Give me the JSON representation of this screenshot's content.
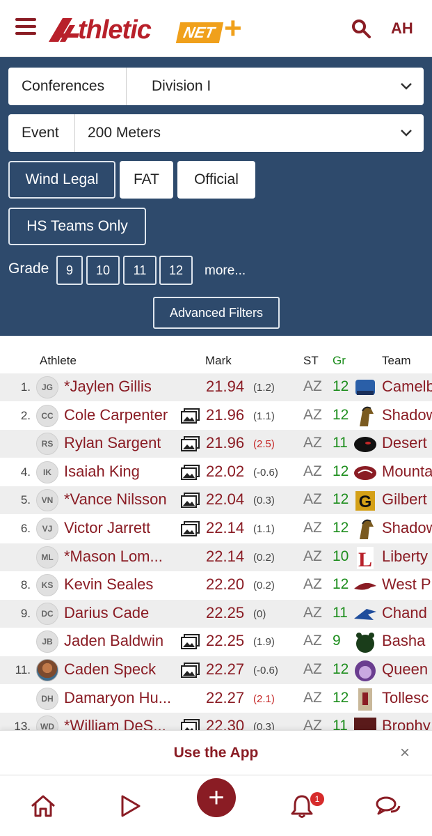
{
  "header": {
    "logo_word": "thletic",
    "logo_net": "NET",
    "logo_plus": "+",
    "user_initials": "AH"
  },
  "filters": {
    "conferences": {
      "label": "Conferences",
      "value": "Division I"
    },
    "event": {
      "label": "Event",
      "value": "200 Meters"
    },
    "toggles": [
      "Wind Legal",
      "FAT",
      "Official"
    ],
    "hs_teams_only": "HS Teams Only",
    "grade_label": "Grade",
    "grades": [
      "9",
      "10",
      "11",
      "12"
    ],
    "more": "more...",
    "advanced": "Advanced Filters"
  },
  "table": {
    "columns": {
      "athlete": "Athlete",
      "mark": "Mark",
      "st": "ST",
      "gr": "Gr",
      "team": "Team"
    },
    "rows": [
      {
        "rank": "1.",
        "initials": "JG",
        "name": "*Jaylen Gillis",
        "photo": false,
        "mark": "21.94",
        "wind": "(1.2)",
        "illegal": false,
        "st": "AZ",
        "gr": "12",
        "team": "Camelb",
        "logo": "trojan-logo"
      },
      {
        "rank": "2.",
        "initials": "CC",
        "name": "Cole Carpenter",
        "photo": true,
        "mark": "21.96",
        "wind": "(1.1)",
        "illegal": false,
        "st": "AZ",
        "gr": "12",
        "team": "Shadow",
        "logo": "stallion-logo"
      },
      {
        "rank": "",
        "initials": "RS",
        "name": "Rylan Sargent",
        "photo": true,
        "mark": "21.96",
        "wind": "(2.5)",
        "illegal": true,
        "st": "AZ",
        "gr": "11",
        "team": "Desert",
        "logo": "panther-logo"
      },
      {
        "rank": "4.",
        "initials": "IK",
        "name": "Isaiah King",
        "photo": true,
        "mark": "22.02",
        "wind": "(-0.6)",
        "illegal": false,
        "st": "AZ",
        "gr": "12",
        "team": "Mounta",
        "logo": "hawk-logo"
      },
      {
        "rank": "5.",
        "initials": "VN",
        "name": "*Vance Nilsson",
        "photo": true,
        "mark": "22.04",
        "wind": "(0.3)",
        "illegal": false,
        "st": "AZ",
        "gr": "12",
        "team": "Gilbert",
        "logo": "g-logo"
      },
      {
        "rank": "6.",
        "initials": "VJ",
        "name": "Victor Jarrett",
        "photo": true,
        "mark": "22.14",
        "wind": "(1.1)",
        "illegal": false,
        "st": "AZ",
        "gr": "12",
        "team": "Shadow",
        "logo": "stallion-logo"
      },
      {
        "rank": "",
        "initials": "ML",
        "name": "*Mason Lom...",
        "photo": false,
        "mark": "22.14",
        "wind": "(0.2)",
        "illegal": false,
        "st": "AZ",
        "gr": "10",
        "team": "Liberty",
        "logo": "l-logo"
      },
      {
        "rank": "8.",
        "initials": "KS",
        "name": "Kevin Seales",
        "photo": false,
        "mark": "22.20",
        "wind": "(0.2)",
        "illegal": false,
        "st": "AZ",
        "gr": "12",
        "team": "West P",
        "logo": "bird-logo"
      },
      {
        "rank": "9.",
        "initials": "DC",
        "name": "Darius Cade",
        "photo": false,
        "mark": "22.25",
        "wind": "(0)",
        "illegal": false,
        "st": "AZ",
        "gr": "11",
        "team": "Chand",
        "logo": "wolf-logo"
      },
      {
        "rank": "",
        "initials": "JB",
        "name": "Jaden Baldwin",
        "photo": true,
        "mark": "22.25",
        "wind": "(1.9)",
        "illegal": false,
        "st": "AZ",
        "gr": "9",
        "team": "Basha",
        "logo": "bear-logo"
      },
      {
        "rank": "11.",
        "initials": "",
        "name": "Caden Speck",
        "photo": true,
        "mark": "22.27",
        "wind": "(-0.6)",
        "illegal": false,
        "st": "AZ",
        "gr": "12",
        "team": "Queen",
        "logo": "bulldog-logo",
        "avatar_photo": true
      },
      {
        "rank": "",
        "initials": "DH",
        "name": "Damaryon Hu...",
        "photo": false,
        "mark": "22.27",
        "wind": "(2.1)",
        "illegal": true,
        "st": "AZ",
        "gr": "12",
        "team": "Tollesc",
        "logo": "runner-photo"
      },
      {
        "rank": "13.",
        "initials": "WD",
        "name": "*William DeS...",
        "photo": true,
        "mark": "22.30",
        "wind": "(0.3)",
        "illegal": false,
        "st": "AZ",
        "gr": "11",
        "team": "Brophy",
        "logo": "team-photo"
      }
    ]
  },
  "app_banner": {
    "text": "Use the App",
    "close": "×"
  },
  "bottom_nav": {
    "add": "+",
    "notification_count": "1"
  },
  "colors": {
    "brand": "#8a1c24",
    "panel": "#2e4a6c",
    "grade": "#1e8e1e",
    "accent": "#f0a01b"
  }
}
